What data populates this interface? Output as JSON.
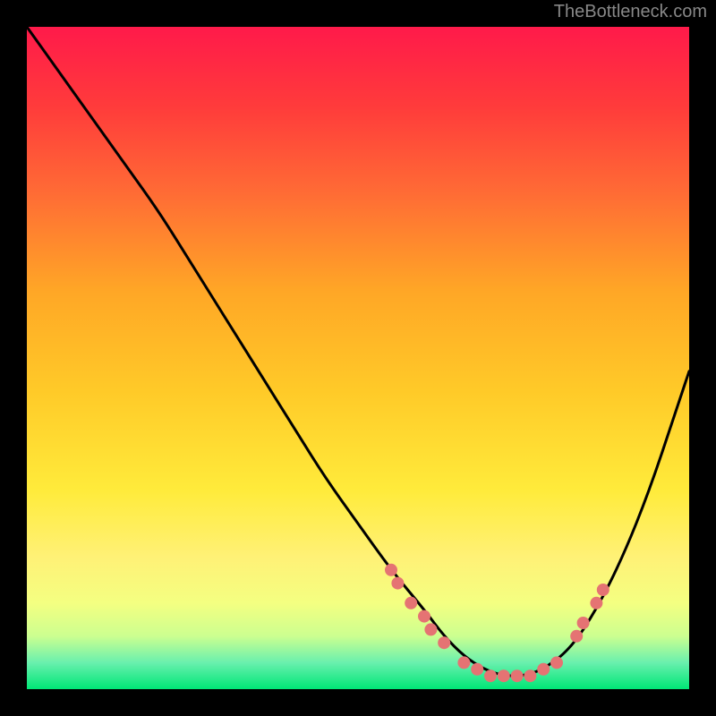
{
  "watermark": "TheBottleneck.com",
  "chart_data": {
    "type": "line",
    "title": "",
    "xlabel": "",
    "ylabel": "",
    "xlim": [
      0,
      100
    ],
    "ylim": [
      0,
      100
    ],
    "background_gradient": [
      "#ff1744",
      "#ff5252",
      "#ff9800",
      "#ffc107",
      "#ffeb3b",
      "#fff176",
      "#f0f4c3",
      "#c5e1a5",
      "#66bb6a",
      "#00c853"
    ],
    "curve": {
      "description": "V-shaped bottleneck curve",
      "x": [
        0,
        5,
        10,
        15,
        20,
        25,
        30,
        35,
        40,
        45,
        50,
        55,
        60,
        63,
        66,
        69,
        72,
        75,
        78,
        82,
        86,
        90,
        94,
        98,
        100
      ],
      "y": [
        100,
        93,
        86,
        79,
        72,
        64,
        56,
        48,
        40,
        32,
        25,
        18,
        12,
        8,
        5,
        3,
        2,
        2,
        3,
        6,
        12,
        20,
        30,
        42,
        48
      ]
    },
    "highlight_points": {
      "color": "#e57373",
      "points": [
        {
          "x": 55,
          "y": 18
        },
        {
          "x": 56,
          "y": 16
        },
        {
          "x": 58,
          "y": 13
        },
        {
          "x": 60,
          "y": 11
        },
        {
          "x": 61,
          "y": 9
        },
        {
          "x": 63,
          "y": 7
        },
        {
          "x": 66,
          "y": 4
        },
        {
          "x": 68,
          "y": 3
        },
        {
          "x": 70,
          "y": 2
        },
        {
          "x": 72,
          "y": 2
        },
        {
          "x": 74,
          "y": 2
        },
        {
          "x": 76,
          "y": 2
        },
        {
          "x": 78,
          "y": 3
        },
        {
          "x": 80,
          "y": 4
        },
        {
          "x": 83,
          "y": 8
        },
        {
          "x": 84,
          "y": 10
        },
        {
          "x": 86,
          "y": 13
        },
        {
          "x": 87,
          "y": 15
        }
      ]
    }
  }
}
